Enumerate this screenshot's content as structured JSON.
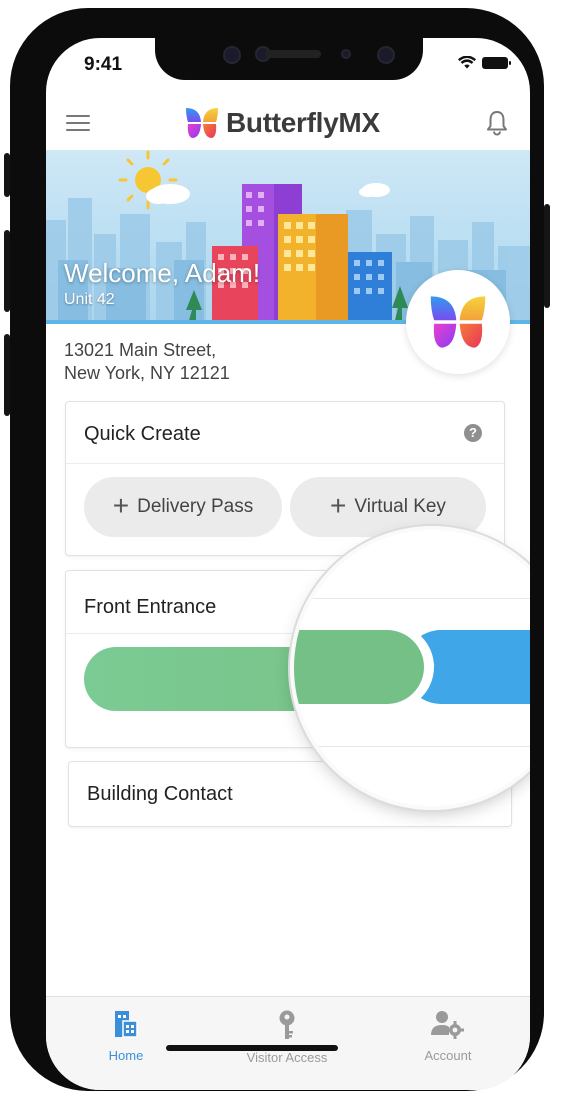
{
  "status_bar": {
    "time": "9:41"
  },
  "header": {
    "brand": "ButterflyMX"
  },
  "banner": {
    "welcome": "Welcome, Adam!",
    "unit": "Unit 42"
  },
  "address": {
    "line1": "13021 Main Street,",
    "line2": "New York, NY 12121"
  },
  "quick_create": {
    "title": "Quick Create",
    "help_symbol": "?",
    "buttons": [
      {
        "label": "Delivery Pass",
        "icon": "plus-icon"
      },
      {
        "label": "Virtual Key",
        "icon": "plus-icon"
      }
    ]
  },
  "front_entrance": {
    "title": "Front Entrance",
    "slider_icon": "swipe-slider"
  },
  "building_contact": {
    "title": "Building Contact"
  },
  "bottom_nav": [
    {
      "label": "Home",
      "icon": "building-icon",
      "active": true
    },
    {
      "label": "Visitor Access",
      "icon": "key-icon",
      "active": false
    },
    {
      "label": "Account",
      "icon": "user-gear-icon",
      "active": false
    }
  ],
  "colors": {
    "accent_blue": "#3fa6e7",
    "slider_green": "#79c48a",
    "nav_active": "#3b8fd9",
    "nav_inactive": "#9a9a9a"
  }
}
